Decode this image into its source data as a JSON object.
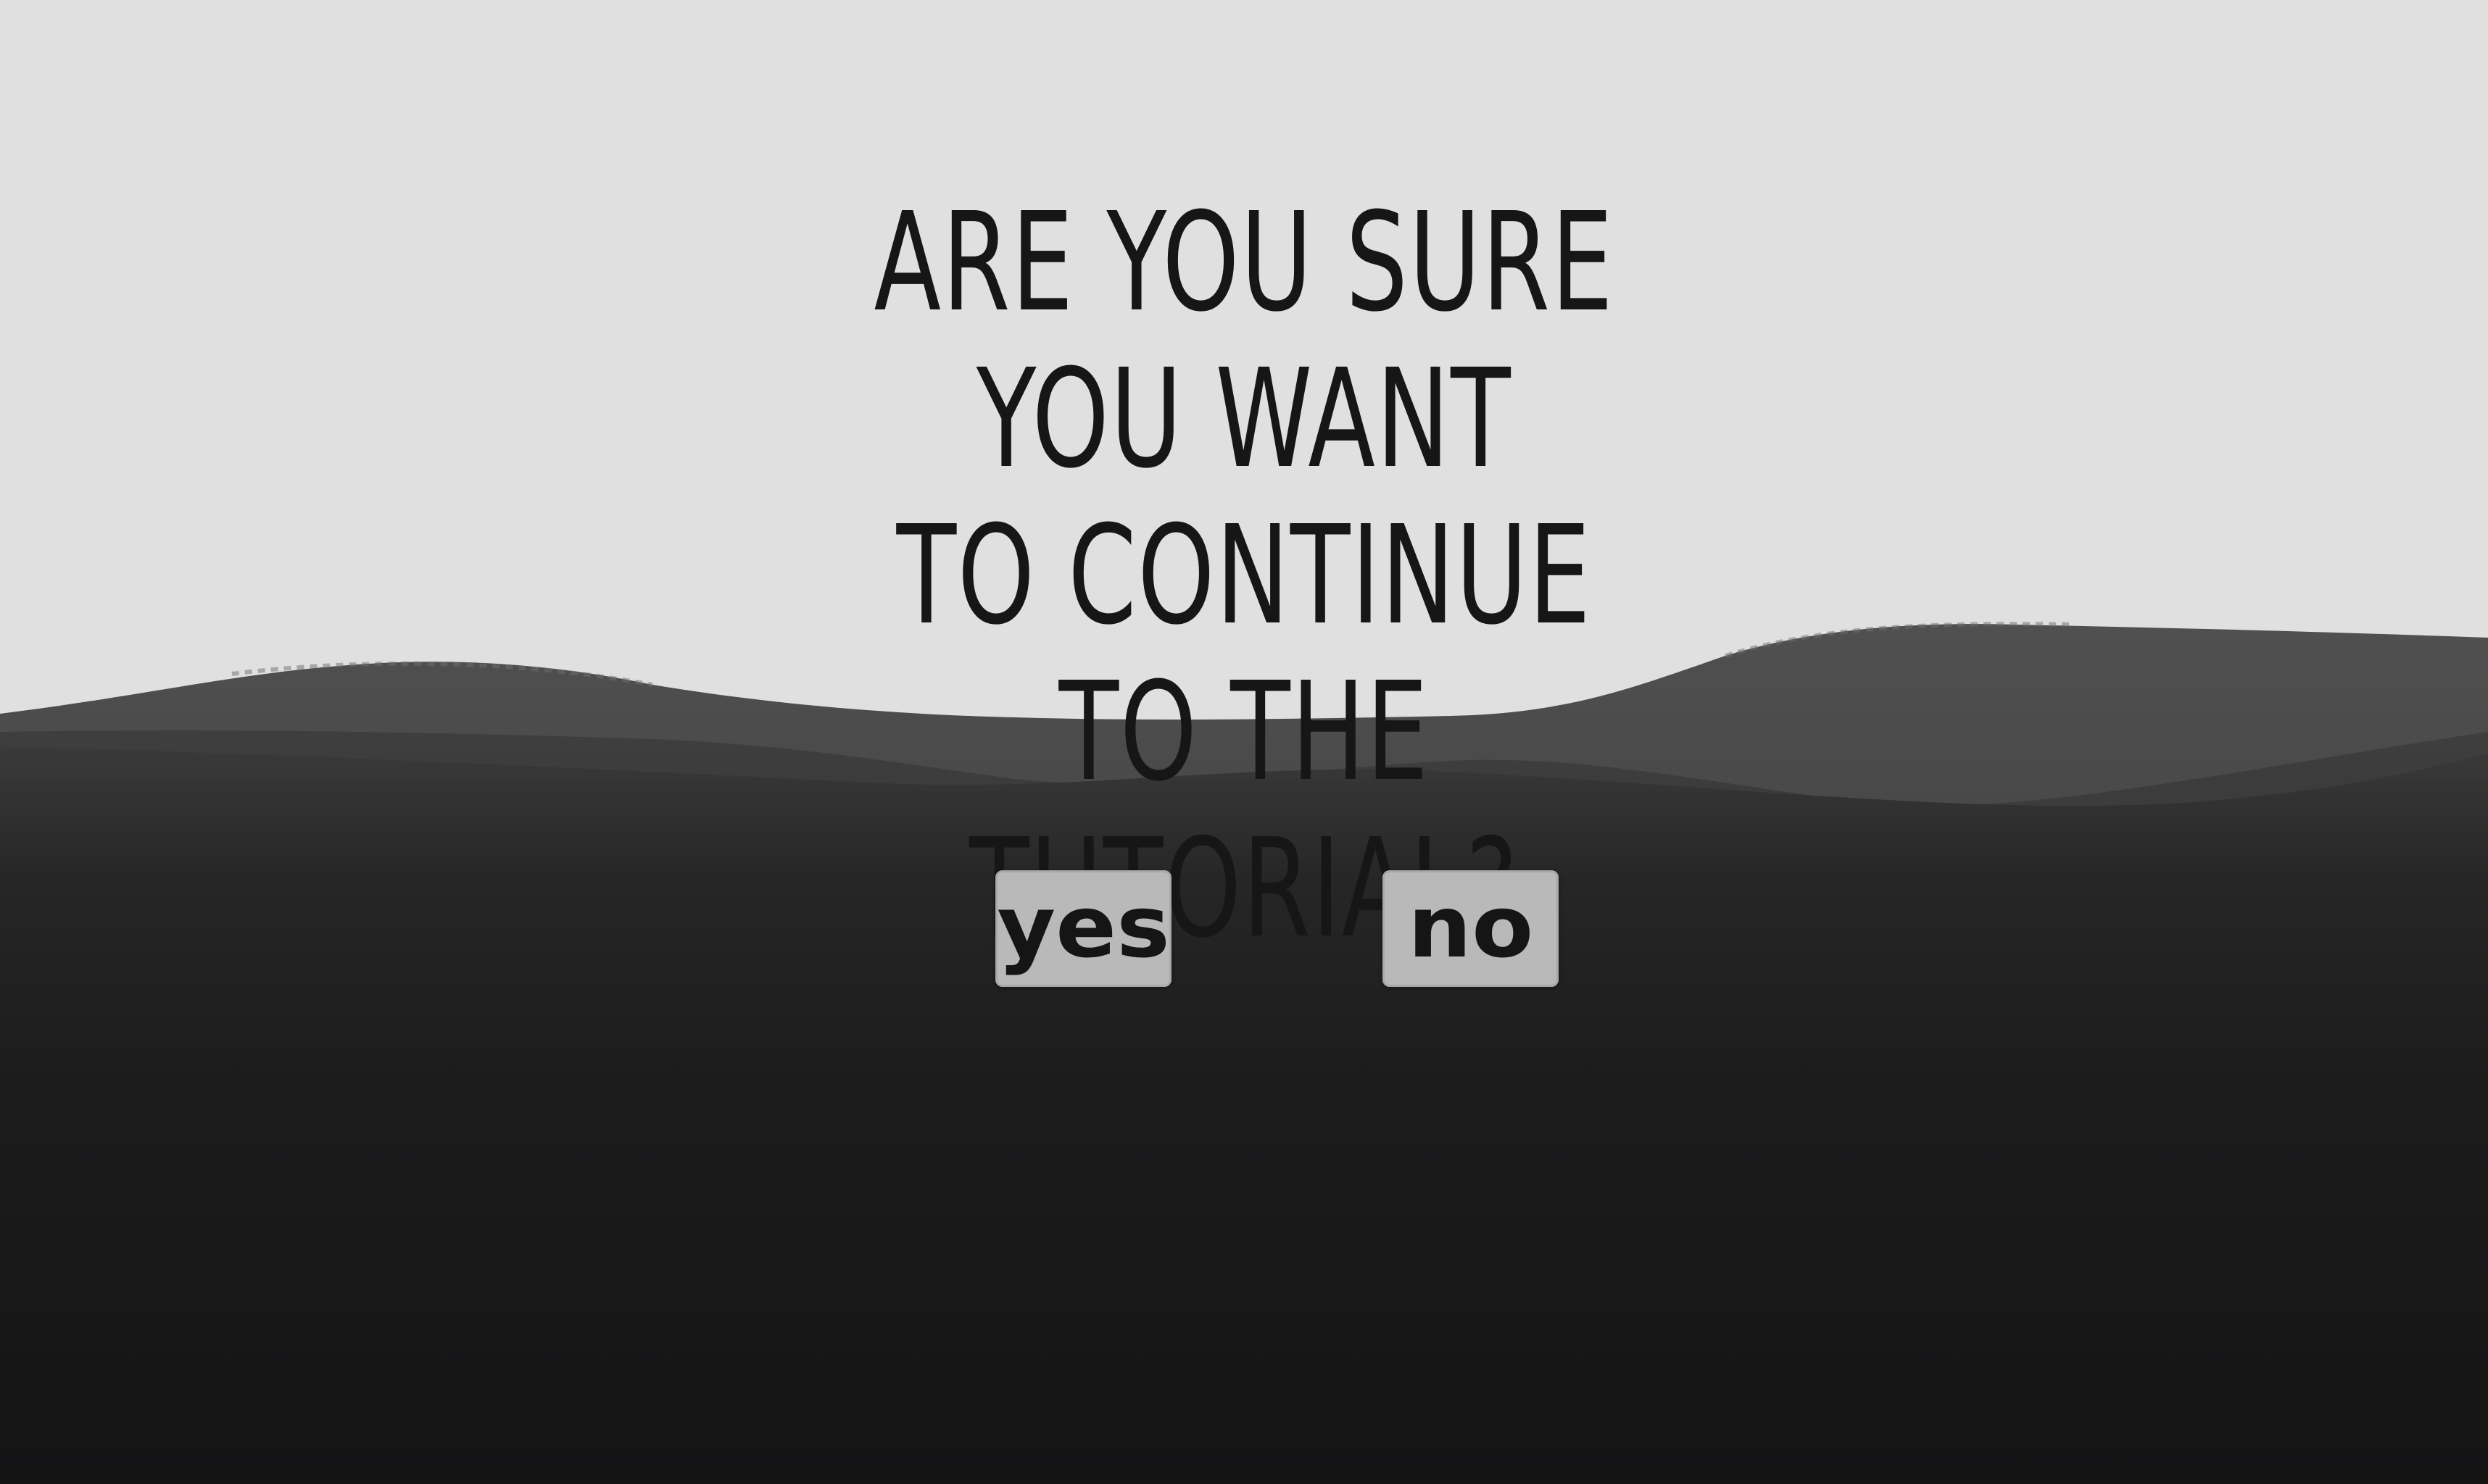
{
  "dialog": {
    "prompt_lines": [
      "ARE YOU SURE YOU WANT",
      "TO CONTINUE TO THE",
      "TUTORIAL?"
    ],
    "yes_label": "yes",
    "no_label": "no"
  },
  "colors": {
    "sky": "#e0e0e0",
    "far_hills": "#4a4a4b",
    "mid_hills": "#353536",
    "foreground": "#161617",
    "text": "#161616",
    "button_fill": "#b9b9b9"
  }
}
